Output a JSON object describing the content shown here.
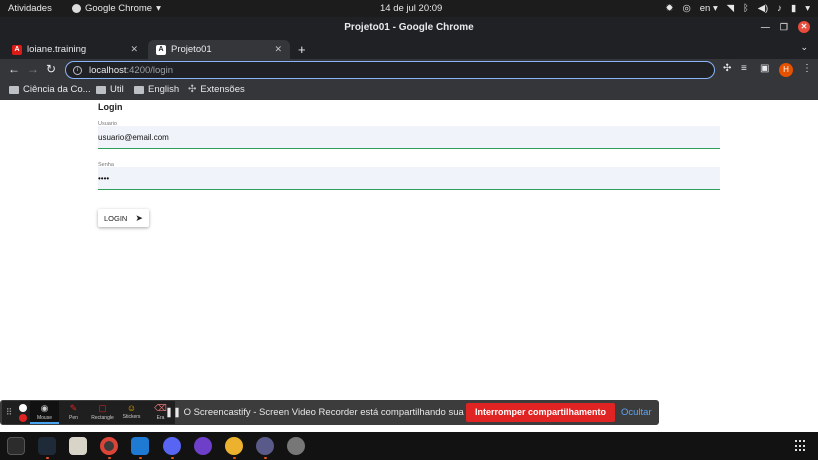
{
  "gnome_topbar": {
    "activities": "Atividades",
    "app_menu": "Google Chrome",
    "clock": "14 de jul  20:09",
    "keyboard_layout": "en"
  },
  "window": {
    "title": "Projeto01 - Google Chrome"
  },
  "tabs": [
    {
      "label": "loiane.training",
      "favicon": "angular-icon",
      "active": false
    },
    {
      "label": "Projeto01",
      "favicon": "angular-icon",
      "active": true
    }
  ],
  "address_bar": {
    "host": "localhost",
    "path": ":4200/login"
  },
  "bookmarks": [
    {
      "label": "Ciência da Co...",
      "icon": "folder-icon"
    },
    {
      "label": "Util",
      "icon": "folder-icon"
    },
    {
      "label": "English",
      "icon": "folder-icon"
    },
    {
      "label": "Extensões",
      "icon": "puzzle-icon"
    }
  ],
  "profile": {
    "initial": "H",
    "color": "#e65100"
  },
  "login_form": {
    "heading": "Login",
    "username_label": "Usuario",
    "username_value": "usuario@email.com",
    "password_label": "Senha",
    "password_value": "••••",
    "submit_label": "LOGIN",
    "accent_color": "#2e9e5b"
  },
  "screencastify": {
    "tools": [
      {
        "label": "Mouse",
        "icon": "cursor-icon"
      },
      {
        "label": "Pen",
        "icon": "pen-icon"
      },
      {
        "label": "Rectangle",
        "icon": "rectangle-icon"
      },
      {
        "label": "Stickers",
        "icon": "sticker-icon"
      },
      {
        "label": "Era",
        "icon": "eraser-icon"
      }
    ],
    "message": "O Screencastify - Screen Video Recorder está compartilhando sua tela.",
    "stop_button": "Interromper compartilhamento",
    "hide_button": "Ocultar",
    "stop_color": "#e02424"
  }
}
